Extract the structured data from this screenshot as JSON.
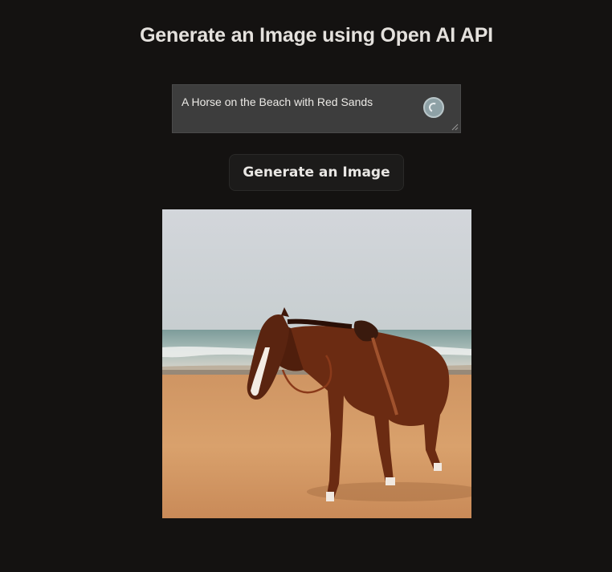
{
  "header": {
    "title": "Generate an Image using Open AI API"
  },
  "prompt": {
    "value": "A Horse on the Beach with Red Sands",
    "loading_icon": "spinner-icon"
  },
  "actions": {
    "generate_label": "Generate an Image"
  },
  "result": {
    "image_icon": "generated-image"
  }
}
